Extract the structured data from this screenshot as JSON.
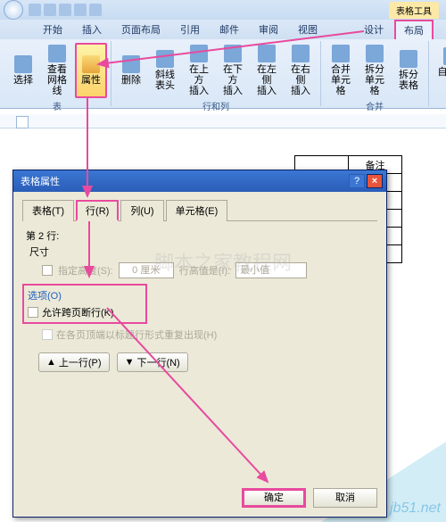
{
  "titlebar": {
    "tool_context": "表格工具"
  },
  "ribbon_tabs": {
    "home": "开始",
    "insert": "插入",
    "page_layout": "页面布局",
    "references": "引用",
    "mail": "邮件",
    "review": "审阅",
    "view": "视图",
    "design": "设计",
    "layout": "布局"
  },
  "ribbon": {
    "select": "选择",
    "gridlines_view": "查看",
    "gridlines": "网格线",
    "properties": "属性",
    "delete": "删除",
    "diag_header": "斜线表头",
    "insert_above": "在上方",
    "insert": "插入",
    "insert_below": "在下方",
    "insert_left": "在左侧",
    "insert_right": "在右侧",
    "merge": "合并",
    "cells": "单元格",
    "split": "拆分",
    "split_table": "表格",
    "autofit": "自动调整",
    "group_table": "表",
    "group_rowcol": "行和列",
    "group_merge": "合并"
  },
  "bg_table": {
    "header": "备注"
  },
  "dialog": {
    "title": "表格属性",
    "tabs": {
      "table": "表格(T)",
      "row": "行(R)",
      "column": "列(U)",
      "cell": "单元格(E)"
    },
    "row_info": "第 2 行:",
    "size_label": "尺寸",
    "spec_height": "指定高度(S):",
    "height_value": "0 厘米",
    "height_is": "行高值是(I):",
    "height_type": "最小值",
    "options_label": "选项(O)",
    "allow_break": "允许跨页断行(K)",
    "repeat_header": "在各页顶端以标题行形式重复出现(H)",
    "prev_row": "上一行(P)",
    "next_row": "下一行(N)",
    "ok": "确定",
    "cancel": "取消"
  },
  "watermark": "jb51.net",
  "watermark2": "脚本之家教程网"
}
